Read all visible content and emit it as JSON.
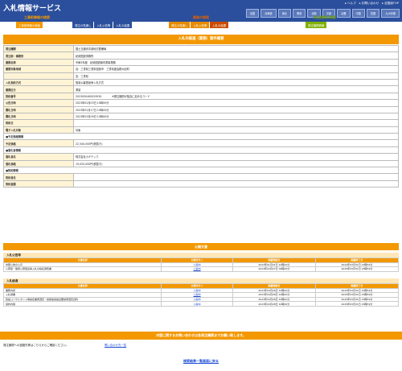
{
  "header": {
    "logo": "入札情報サービス",
    "topnav": [
      "ヘルプ",
      "お問い合わせ",
      "全国版TOP"
    ],
    "regions": [
      "全国",
      "北海道",
      "東北",
      "関東",
      "北陸",
      "中部",
      "近畿",
      "中国",
      "四国",
      "九州沖縄"
    ]
  },
  "categories": {
    "groups": [
      {
        "title": "工事前情報の検索",
        "buttons": [
          "工事前情報の検索"
        ]
      },
      {
        "title": "工事の検索",
        "buttons": [
          "発注の見通し",
          "入札公告等",
          "入札の結果"
        ]
      },
      {
        "title": "業務の検索",
        "buttons": [
          "発注の見通し",
          "入札公告等",
          "入札の結果"
        ]
      },
      {
        "title": "発注機関の検索",
        "buttons": [
          "発注機関情報"
        ]
      }
    ]
  },
  "detail": {
    "title": "入札の経過（業務）案件概要",
    "rows": [
      {
        "label": "発注機関",
        "value": "国土交通省中部地方整備局"
      },
      {
        "label": "発注部・事務所",
        "value": "紀勢国道事務所"
      },
      {
        "label": "業務名称",
        "value": "令和5年度　紀勢国道管内測量業務"
      },
      {
        "label": "業務対象地域",
        "value": "自：三重県三重県松阪市　三重県度会郡大紀町"
      },
      {
        "label": "",
        "value": "至：三重県"
      },
      {
        "label": "入札契約方式",
        "value": "簡易公募型競争入札方式"
      },
      {
        "label": "業務区分",
        "value": "測量"
      },
      {
        "label": "契約番号",
        "value": "2023050400029530　　　　※発注機関が独自に定めるコード"
      },
      {
        "label": "公告日時",
        "value": "2023年02月03日 10時00分"
      },
      {
        "label": "開札日時",
        "value": "2023年02月17日 10時00分"
      },
      {
        "label": "開札日時",
        "value": "2023年03月09日 10時00分"
      },
      {
        "label": "契約日",
        "value": ""
      },
      {
        "label": "電子入札対象",
        "value": "対象"
      },
      {
        "label": "■予定価格情報",
        "value": "",
        "section": true
      },
      {
        "label": "予定価格",
        "value": "22,540,000円(税抜き)"
      },
      {
        "label": "■落札者情報",
        "value": "",
        "section": true
      },
      {
        "label": "落札者名",
        "value": "株式会社カギテック"
      },
      {
        "label": "落札価格",
        "value": "19,020,000円(税抜き)"
      },
      {
        "label": "■契約情報",
        "value": "",
        "section": true
      },
      {
        "label": "契約者名",
        "value": ""
      },
      {
        "label": "契約金額",
        "value": ""
      }
    ]
  },
  "public_docs": {
    "title": "公開文書",
    "headers": [
      "文書名称",
      "公開ボタン",
      "掲載開始日",
      "掲載終了日"
    ],
    "sections": [
      {
        "name": "入札公告等",
        "rows": [
          {
            "name": "中部公告の公示",
            "link": "公開中",
            "start": "2023年01月31日 10時00分",
            "end": "2024年03月31日 23時59分"
          },
          {
            "name": "公募型・簡易公募型競争入札の指名通知書",
            "link": "公開中",
            "start": "2023年04月27日 09時00分",
            "end": "2025年03月31日 23時59分"
          }
        ]
      },
      {
        "name": "入札経過",
        "rows": [
          {
            "name": "業務内訳",
            "link": "公開中",
            "start": "2023年04月28日 10時00分",
            "end": "2025年03月31日 23時59分"
          },
          {
            "name": "入札調書",
            "link": "公開中",
            "start": "2023年04月28日 10時00分",
            "end": "2025年03月31日 23時59分"
          },
          {
            "name": "建設コンサルタント等指名業者選定・技術提案提出要請者選定資料",
            "link": "公開中",
            "start": "2023年04月28日 10時00分",
            "end": "2025年03月31日 23時59分"
          },
          {
            "name": "契約内容",
            "link": "公開中",
            "start": "2023年04月28日 10時00分",
            "end": "2025年03月31日 23時59分"
          }
        ]
      }
    ]
  },
  "footer": {
    "contact_bar": "内容に関するお問い合わせは各発注機関までお願い致します。",
    "contact_text": "発注機関への連絡先等はこちらからご確認ください。",
    "contact_link": "問い合わせ先一覧",
    "back_link": "検索結果一覧画面に戻る"
  }
}
